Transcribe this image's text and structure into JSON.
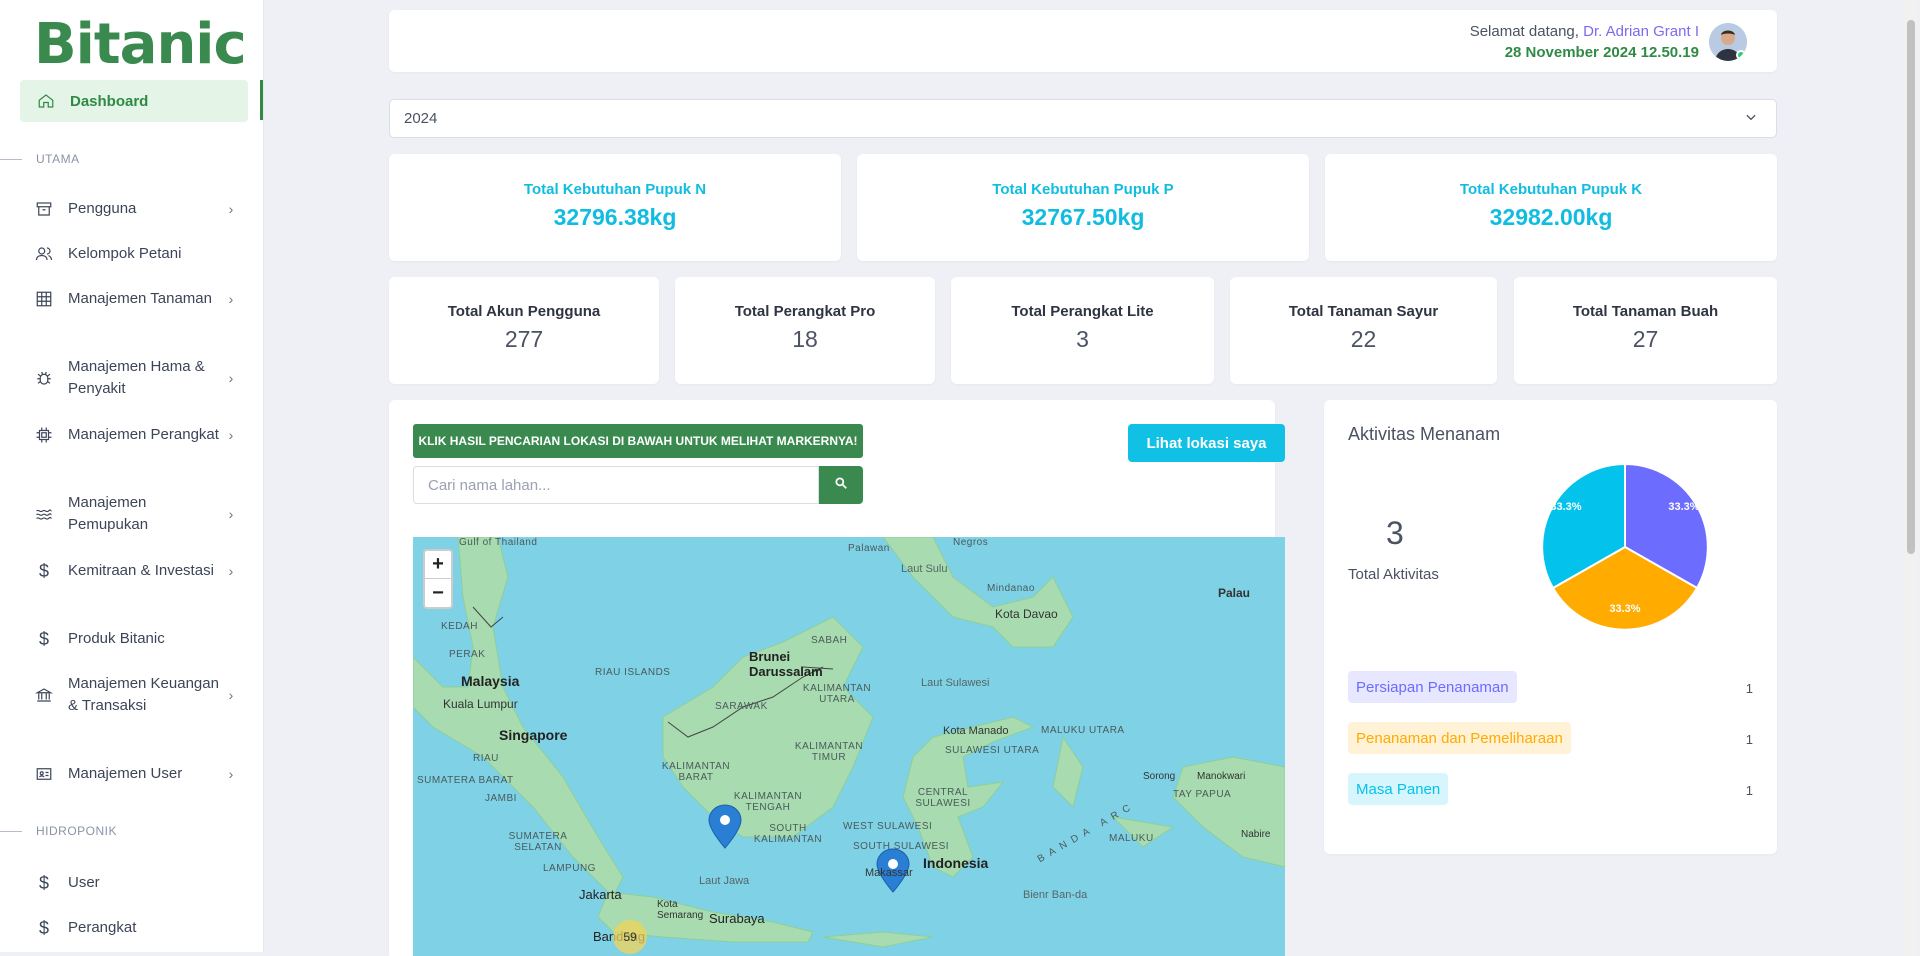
{
  "sidebar": {
    "brand": "Bitanic",
    "dashboard": "Dashboard",
    "section_main": "UTAMA",
    "section_hydro": "HIDROPONIK",
    "items": [
      {
        "label": "Pengguna",
        "icon": "archive-icon",
        "chevron": true
      },
      {
        "label": "Kelompok Petani",
        "icon": "users-icon",
        "chevron": false
      },
      {
        "label": "Manajemen Tanaman",
        "icon": "grid-icon",
        "chevron": true
      },
      {
        "label": "Manajemen Hama & Penyakit",
        "icon": "bug-icon",
        "chevron": true
      },
      {
        "label": "Manajemen Perangkat",
        "icon": "chip-icon",
        "chevron": true
      },
      {
        "label": "Manajemen Pemupukan",
        "icon": "waves-icon",
        "chevron": true
      },
      {
        "label": "Kemitraan & Investasi",
        "icon": "dollar-icon",
        "chevron": true
      },
      {
        "label": "Produk Bitanic",
        "icon": "dollar-icon",
        "chevron": false
      },
      {
        "label": "Manajemen Keuangan & Transaksi",
        "icon": "bank-icon",
        "chevron": true
      },
      {
        "label": "Manajemen User",
        "icon": "id-card-icon",
        "chevron": true
      }
    ],
    "hydro_items": [
      {
        "label": "User",
        "icon": "dollar-icon"
      },
      {
        "label": "Perangkat",
        "icon": "dollar-icon"
      }
    ]
  },
  "header": {
    "greeting": "Selamat datang, ",
    "user_name": "Dr. Adrian Grant I",
    "datetime": "28 November 2024 12.50.19"
  },
  "year_select": {
    "value": "2024"
  },
  "fertilizer_stats": [
    {
      "title": "Total Kebutuhan Pupuk N",
      "value": "32796.38kg"
    },
    {
      "title": "Total Kebutuhan Pupuk P",
      "value": "32767.50kg"
    },
    {
      "title": "Total Kebutuhan Pupuk K",
      "value": "32982.00kg"
    }
  ],
  "count_stats": [
    {
      "title": "Total Akun Pengguna",
      "value": "277"
    },
    {
      "title": "Total Perangkat Pro",
      "value": "18"
    },
    {
      "title": "Total Perangkat Lite",
      "value": "3"
    },
    {
      "title": "Total Tanaman Sayur",
      "value": "22"
    },
    {
      "title": "Total Tanaman Buah",
      "value": "27"
    }
  ],
  "map_panel": {
    "notice": "KLIK HASIL PENCARIAN LOKASI DI BAWAH UNTUK MELIHAT MARKERNYA!",
    "locate_button": "Lihat lokasi saya",
    "search_placeholder": "Cari nama lahan...",
    "zoom_in": "+",
    "zoom_out": "−",
    "cluster_count": "59",
    "labels": {
      "gulf": "Gulf of Thailand",
      "palawan": "Palawan",
      "negros": "Negros",
      "laut_sulu": "Laut Sulu",
      "mindanao": "Mindanao",
      "kota_davao": "Kota Davao",
      "palau": "Palau",
      "kedah": "KEDAH",
      "perak": "PERAK",
      "malaysia": "Malaysia",
      "kuala_lumpur": "Kuala Lumpur",
      "riau_islands": "RIAU ISLANDS",
      "sabah": "SABAH",
      "brunei": "Brunei Darussalam",
      "sarawak": "SARAWAK",
      "kalimantan_utara": "KALIMANTAN UTARA",
      "laut_sulawesi": "Laut Sulawesi",
      "singapore": "Singapore",
      "riau": "RIAU",
      "kalimantan_barat": "KALIMANTAN BARAT",
      "kalimantan_timur": "KALIMANTAN TIMUR",
      "kota_manado": "Kota Manado",
      "maluku_utara": "MALUKU UTARA",
      "sulawesi_utara": "SULAWESI UTARA",
      "sumatera_barat": "SUMATERA BARAT",
      "jambi": "JAMBI",
      "kalimantan_tengah": "KALIMANTAN TENGAH",
      "central_sulawesi": "CENTRAL SULAWESI",
      "sorong": "Sorong",
      "manokwari": "Manokwari",
      "tay_papua": "TAY PAPUA",
      "sumatera_selatan": "SUMATERA SELATAN",
      "kalimantan_selatan": "SOUTH KALIMANTAN",
      "west_sulawesi": "WEST SULAWESI",
      "south_sulawesi": "SOUTH SULAWESI",
      "banda": "BANDA ARC",
      "maluku": "MALUKU",
      "nabire": "Nabire",
      "lampung": "LAMPUNG",
      "makassar": "Makassar",
      "indonesia": "Indonesia",
      "jakarta": "Jakarta",
      "laut_jawa": "Laut Jawa",
      "kota_semarang": "Kota Semarang",
      "surabaya": "Surabaya",
      "bandung": "Bandung",
      "bienr": "Bienr Ban-da"
    }
  },
  "activity": {
    "title": "Aktivitas Menanam",
    "total": "3",
    "total_label": "Total Aktivitas",
    "slice_labels": [
      "33.3%",
      "33.3%",
      "33.3%"
    ],
    "colors": [
      "#6c6cff",
      "#ffab00",
      "#03c3ec"
    ],
    "legend": [
      {
        "label": "Persiapan Penanaman",
        "count": "1",
        "bg": "#e7e7ff",
        "fg": "#6c6cff"
      },
      {
        "label": "Penanaman dan Pemeliharaan",
        "count": "1",
        "bg": "#fff2d6",
        "fg": "#ffab00"
      },
      {
        "label": "Masa Panen",
        "count": "1",
        "bg": "#d7f5fc",
        "fg": "#03c3ec"
      }
    ]
  }
}
